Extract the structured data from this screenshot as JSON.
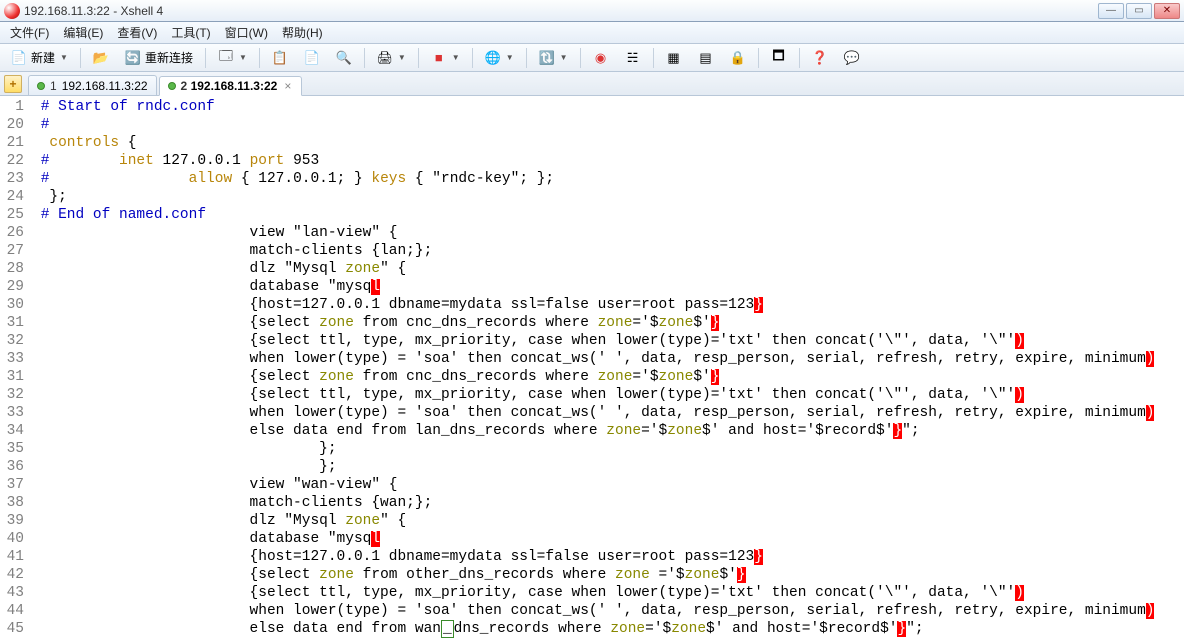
{
  "window": {
    "title": "192.168.11.3:22 - Xshell 4",
    "min": "—",
    "max": "▭",
    "close": "✕"
  },
  "menu": {
    "items": [
      "文件(F)",
      "编辑(E)",
      "查看(V)",
      "工具(T)",
      "窗口(W)",
      "帮助(H)"
    ]
  },
  "toolbar": {
    "new_label": "新建",
    "reconnect_label": "重新连接"
  },
  "tabs": {
    "t1_idx": "1",
    "t1_label": "192.168.11.3:22",
    "t2_idx": "2",
    "t2_label": "192.168.11.3:22",
    "close": "×",
    "add": "+"
  },
  "code": [
    {
      "n": "1",
      "segs": [
        {
          "t": " ",
          "c": ""
        },
        {
          "t": "# Start of rndc.conf",
          "c": "c-com"
        }
      ]
    },
    {
      "n": "20",
      "segs": [
        {
          "t": " ",
          "c": ""
        },
        {
          "t": "#",
          "c": "c-com"
        }
      ]
    },
    {
      "n": "21",
      "segs": [
        {
          "t": "  ",
          "c": ""
        },
        {
          "t": "controls",
          "c": "c-kw"
        },
        {
          "t": " {",
          "c": ""
        }
      ]
    },
    {
      "n": "22",
      "segs": [
        {
          "t": " ",
          "c": ""
        },
        {
          "t": "#",
          "c": "c-com"
        },
        {
          "t": "        ",
          "c": ""
        },
        {
          "t": "inet",
          "c": "c-kw"
        },
        {
          "t": " 127.0.0.1 ",
          "c": ""
        },
        {
          "t": "port",
          "c": "c-kw"
        },
        {
          "t": " 953",
          "c": ""
        }
      ]
    },
    {
      "n": "23",
      "segs": [
        {
          "t": " ",
          "c": ""
        },
        {
          "t": "#",
          "c": "c-com"
        },
        {
          "t": "                ",
          "c": ""
        },
        {
          "t": "allow",
          "c": "c-kw"
        },
        {
          "t": " { 127.0.0.1; } ",
          "c": ""
        },
        {
          "t": "keys",
          "c": "c-kw"
        },
        {
          "t": " { \"rndc-key\"; };",
          "c": ""
        }
      ]
    },
    {
      "n": "24",
      "segs": [
        {
          "t": "  };",
          "c": ""
        }
      ]
    },
    {
      "n": "25",
      "segs": [
        {
          "t": " ",
          "c": ""
        },
        {
          "t": "# End of named.conf",
          "c": "c-com"
        }
      ]
    },
    {
      "n": "26",
      "segs": [
        {
          "t": "                         view \"lan-view\" {",
          "c": ""
        }
      ]
    },
    {
      "n": "27",
      "segs": [
        {
          "t": "                         match-clients {lan;};",
          "c": ""
        }
      ]
    },
    {
      "n": "28",
      "segs": [
        {
          "t": "                         dlz \"Mysql ",
          "c": ""
        },
        {
          "t": "zone",
          "c": "c-str"
        },
        {
          "t": "\" {",
          "c": ""
        }
      ]
    },
    {
      "n": "29",
      "segs": [
        {
          "t": "                         database \"mysq",
          "c": ""
        },
        {
          "t": "l",
          "c": "hl"
        }
      ]
    },
    {
      "n": "30",
      "segs": [
        {
          "t": "                         {host=127.0.0.1 dbname=mydata ssl=false user=root pass=123",
          "c": ""
        },
        {
          "t": "}",
          "c": "hl"
        }
      ]
    },
    {
      "n": "31",
      "segs": [
        {
          "t": "                         {select ",
          "c": ""
        },
        {
          "t": "zone",
          "c": "c-str"
        },
        {
          "t": " from cnc_dns_records where ",
          "c": ""
        },
        {
          "t": "zone",
          "c": "c-str"
        },
        {
          "t": "='$",
          "c": ""
        },
        {
          "t": "zone",
          "c": "c-str"
        },
        {
          "t": "$'",
          "c": ""
        },
        {
          "t": "}",
          "c": "hl"
        }
      ]
    },
    {
      "n": "32",
      "segs": [
        {
          "t": "                         {select ttl, type, mx_priority, case when lower(type)='txt' then concat('\\\"', data, '\\\"'",
          "c": ""
        },
        {
          "t": ")",
          "c": "hl"
        }
      ]
    },
    {
      "n": "33",
      "segs": [
        {
          "t": "                         when lower(type) = 'soa' then concat_ws(' ', data, resp_person, serial, refresh, retry, expire, minimum",
          "c": ""
        },
        {
          "t": ")",
          "c": "hl"
        }
      ]
    },
    {
      "n": "31",
      "segs": [
        {
          "t": "                         {select ",
          "c": ""
        },
        {
          "t": "zone",
          "c": "c-str"
        },
        {
          "t": " from cnc_dns_records where ",
          "c": ""
        },
        {
          "t": "zone",
          "c": "c-str"
        },
        {
          "t": "='$",
          "c": ""
        },
        {
          "t": "zone",
          "c": "c-str"
        },
        {
          "t": "$'",
          "c": ""
        },
        {
          "t": "}",
          "c": "hl"
        }
      ]
    },
    {
      "n": "32",
      "segs": [
        {
          "t": "                         {select ttl, type, mx_priority, case when lower(type)='txt' then concat('\\\"', data, '\\\"'",
          "c": ""
        },
        {
          "t": ")",
          "c": "hl"
        }
      ]
    },
    {
      "n": "33",
      "segs": [
        {
          "t": "                         when lower(type) = 'soa' then concat_ws(' ', data, resp_person, serial, refresh, retry, expire, minimum",
          "c": ""
        },
        {
          "t": ")",
          "c": "hl"
        }
      ]
    },
    {
      "n": "34",
      "segs": [
        {
          "t": "                         else data end from lan_dns_records where ",
          "c": ""
        },
        {
          "t": "zone",
          "c": "c-str"
        },
        {
          "t": "='$",
          "c": ""
        },
        {
          "t": "zone",
          "c": "c-str"
        },
        {
          "t": "$' and host='$record$'",
          "c": ""
        },
        {
          "t": "}",
          "c": "hl"
        },
        {
          "t": "\";",
          "c": ""
        }
      ]
    },
    {
      "n": "35",
      "segs": [
        {
          "t": "                                 };",
          "c": ""
        }
      ]
    },
    {
      "n": "36",
      "segs": [
        {
          "t": "                                 };",
          "c": ""
        }
      ]
    },
    {
      "n": "37",
      "segs": [
        {
          "t": "                         view \"wan-view\" {",
          "c": ""
        }
      ]
    },
    {
      "n": "38",
      "segs": [
        {
          "t": "                         match-clients {wan;};",
          "c": ""
        }
      ]
    },
    {
      "n": "39",
      "segs": [
        {
          "t": "                         dlz \"Mysql ",
          "c": ""
        },
        {
          "t": "zone",
          "c": "c-str"
        },
        {
          "t": "\" {",
          "c": ""
        }
      ]
    },
    {
      "n": "40",
      "segs": [
        {
          "t": "                         database \"mysq",
          "c": ""
        },
        {
          "t": "l",
          "c": "hl"
        }
      ]
    },
    {
      "n": "41",
      "segs": [
        {
          "t": "                         {host=127.0.0.1 dbname=mydata ssl=false user=root pass=123",
          "c": ""
        },
        {
          "t": "}",
          "c": "hl"
        }
      ]
    },
    {
      "n": "42",
      "segs": [
        {
          "t": "                         {select ",
          "c": ""
        },
        {
          "t": "zone",
          "c": "c-str"
        },
        {
          "t": " from other_dns_records where ",
          "c": ""
        },
        {
          "t": "zone",
          "c": "c-str"
        },
        {
          "t": " ='$",
          "c": ""
        },
        {
          "t": "zone",
          "c": "c-str"
        },
        {
          "t": "$'",
          "c": ""
        },
        {
          "t": "}",
          "c": "hl"
        }
      ]
    },
    {
      "n": "43",
      "segs": [
        {
          "t": "                         {select ttl, type, mx_priority, case when lower(type)='txt' then concat('\\\"', data, '\\\"'",
          "c": ""
        },
        {
          "t": ")",
          "c": "hl"
        }
      ]
    },
    {
      "n": "44",
      "segs": [
        {
          "t": "                         when lower(type) = 'soa' then concat_ws(' ', data, resp_person, serial, refresh, retry, expire, minimum",
          "c": ""
        },
        {
          "t": ")",
          "c": "hl"
        }
      ]
    },
    {
      "n": "45",
      "segs": [
        {
          "t": "                         else data end from wan",
          "c": ""
        },
        {
          "t": "_",
          "c": "cur"
        },
        {
          "t": "dns_records where ",
          "c": ""
        },
        {
          "t": "zone",
          "c": "c-str"
        },
        {
          "t": "='$",
          "c": ""
        },
        {
          "t": "zone",
          "c": "c-str"
        },
        {
          "t": "$' and host='$record$'",
          "c": ""
        },
        {
          "t": "}",
          "c": "hl"
        },
        {
          "t": "\";",
          "c": ""
        }
      ]
    }
  ]
}
